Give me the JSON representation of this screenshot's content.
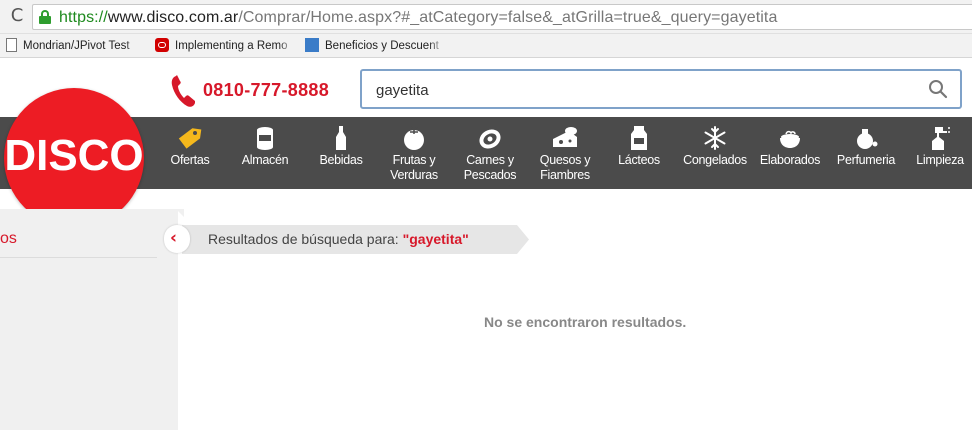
{
  "browser": {
    "reload_glyph": "C",
    "url": {
      "scheme": "https://",
      "host": "www.disco.com.ar",
      "path": "/Comprar/Home.aspx?#_atCategory=false&_atGrilla=true&_query=gayetita"
    },
    "bookmarks": [
      {
        "label": "Mondrian/JPivot Test",
        "icon": "page-icon"
      },
      {
        "label": "Implementing a Remo",
        "icon": "oracle-icon"
      },
      {
        "label": "Beneficios y Descuent",
        "icon": "amex-icon"
      }
    ]
  },
  "header": {
    "phone": "0810-777-8888",
    "search": {
      "value": "gayetita",
      "placeholder": ""
    }
  },
  "logo": {
    "text": "DISCO"
  },
  "nav": {
    "categories": [
      {
        "label": "Ofertas",
        "icon": "tag-icon"
      },
      {
        "label": "Almacén",
        "icon": "can-icon"
      },
      {
        "label": "Bebidas",
        "icon": "bottle-icon"
      },
      {
        "label": "Frutas y Verduras",
        "icon": "tomato-icon"
      },
      {
        "label": "Carnes y Pescados",
        "icon": "steak-icon"
      },
      {
        "label": "Quesos y Fiambres",
        "icon": "cheese-icon"
      },
      {
        "label": "Lácteos",
        "icon": "milk-icon"
      },
      {
        "label": "Congelados",
        "icon": "snowflake-icon"
      },
      {
        "label": "Elaborados",
        "icon": "dish-icon"
      },
      {
        "label": "Perfumeria",
        "icon": "perfume-icon"
      },
      {
        "label": "Limpieza",
        "icon": "spray-icon"
      }
    ]
  },
  "sidebar": {
    "label": "os"
  },
  "results": {
    "breadcrumb_label": "Resultados de búsqueda para:",
    "query": "\"gayetita\"",
    "empty_message": "No se encontraron resultados."
  },
  "colors": {
    "brand_red": "#ed1c24",
    "accent_red": "#d7182a",
    "nav_bg": "#4b4b4b",
    "url_green": "#1e8a1e"
  }
}
